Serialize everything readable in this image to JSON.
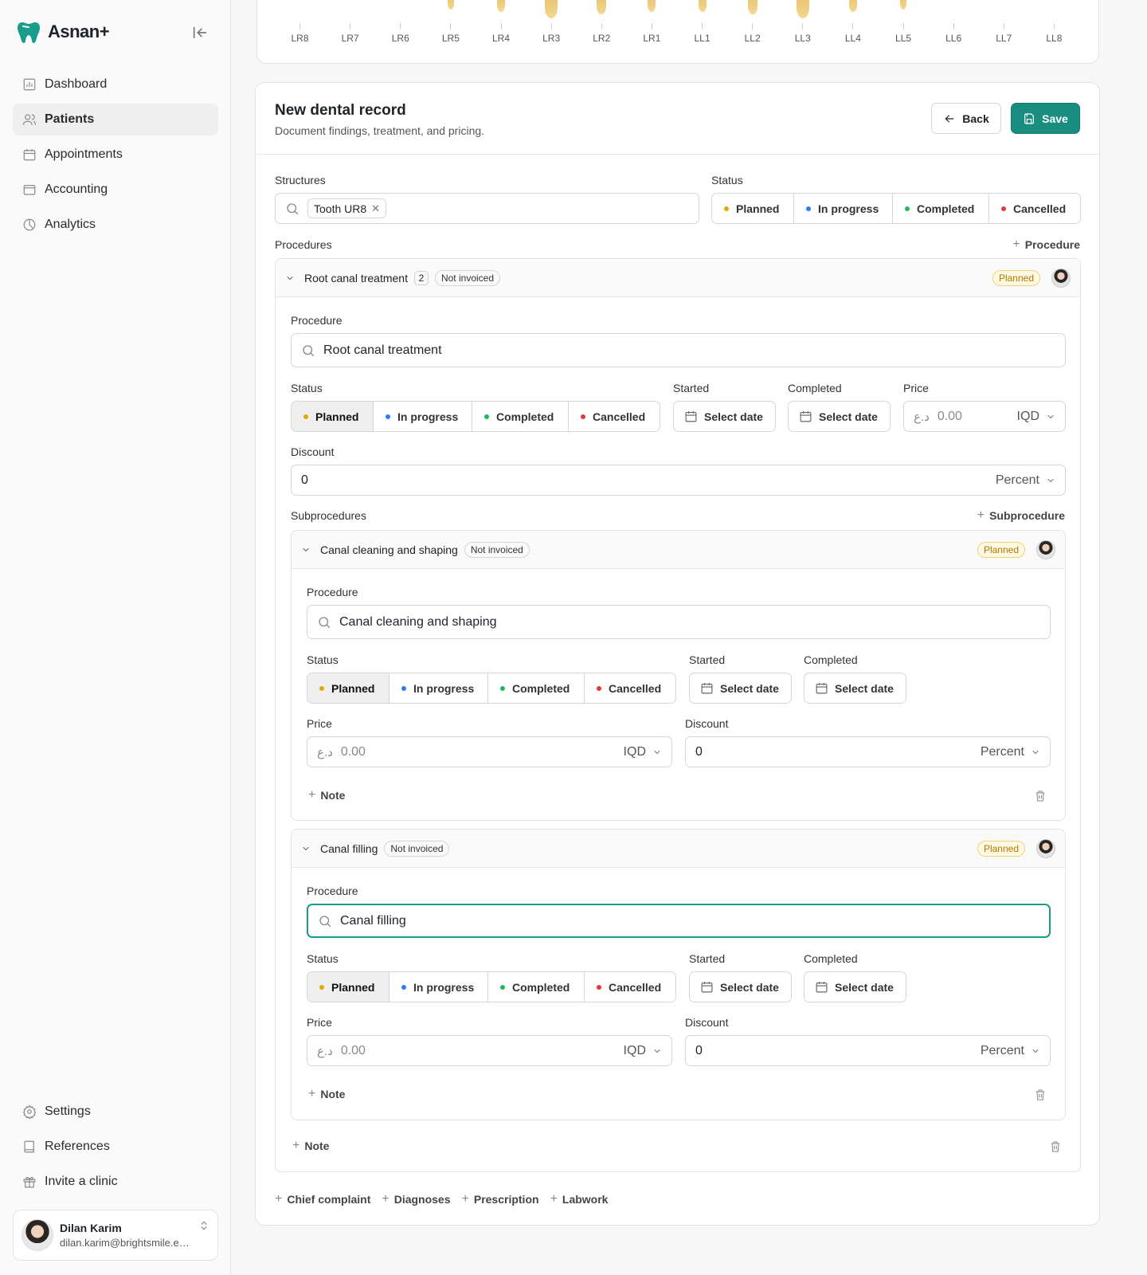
{
  "app": {
    "name": "Asnan+"
  },
  "sidebar": {
    "items": [
      {
        "label": "Dashboard",
        "icon": "chart-bar-icon"
      },
      {
        "label": "Patients",
        "icon": "users-icon"
      },
      {
        "label": "Appointments",
        "icon": "calendar-icon"
      },
      {
        "label": "Accounting",
        "icon": "wallet-icon"
      },
      {
        "label": "Analytics",
        "icon": "pie-chart-icon"
      }
    ],
    "bottom_items": [
      {
        "label": "Settings",
        "icon": "gear-icon"
      },
      {
        "label": "References",
        "icon": "book-icon"
      },
      {
        "label": "Invite a clinic",
        "icon": "gift-icon"
      }
    ],
    "user": {
      "name": "Dilan Karim",
      "email": "dilan.karim@brightsmile.ex..."
    }
  },
  "tooth_chart": {
    "labels": [
      "LR8",
      "LR7",
      "LR6",
      "LR5",
      "LR4",
      "LR3",
      "LR2",
      "LR1",
      "LL1",
      "LL2",
      "LL3",
      "LL4",
      "LL5",
      "LL6",
      "LL7",
      "LL8"
    ]
  },
  "record": {
    "title": "New dental record",
    "subtitle": "Document findings, treatment, and pricing.",
    "back_label": "Back",
    "save_label": "Save",
    "structures_label": "Structures",
    "structure_chip": "Tooth UR8",
    "status_label": "Status",
    "status_options": [
      "Planned",
      "In progress",
      "Completed",
      "Cancelled"
    ],
    "procedures_label": "Procedures",
    "add_procedure_label": "Procedure",
    "footer_links": [
      "Chief complaint",
      "Diagnoses",
      "Prescription",
      "Labwork"
    ]
  },
  "procedure": {
    "name": "Root canal treatment",
    "count": "2",
    "invoice_status": "Not invoiced",
    "status_badge": "Planned",
    "procedure_label": "Procedure",
    "procedure_value": "Root canal treatment",
    "status_label": "Status",
    "status_selected": "Planned",
    "started_label": "Started",
    "completed_label": "Completed",
    "date_placeholder": "Select date",
    "price_label": "Price",
    "currency_prefix": "د.ع",
    "price_placeholder": "0.00",
    "currency": "IQD",
    "discount_label": "Discount",
    "discount_value": "0",
    "discount_unit": "Percent",
    "subprocedures_label": "Subprocedures",
    "add_subprocedure_label": "Subprocedure",
    "note_label": "Note"
  },
  "subprocedures": [
    {
      "name": "Canal cleaning and shaping",
      "invoice_status": "Not invoiced",
      "status_badge": "Planned",
      "procedure_value": "Canal cleaning and shaping",
      "status_selected": "Planned",
      "price_placeholder": "0.00",
      "discount_value": "0",
      "note_label": "Note"
    },
    {
      "name": "Canal filling",
      "invoice_status": "Not invoiced",
      "status_badge": "Planned",
      "procedure_value": "Canal filling",
      "status_selected": "Planned",
      "price_placeholder": "0.00",
      "discount_value": "0",
      "note_label": "Note"
    }
  ],
  "colors": {
    "accent": "#1a8c80",
    "planned": "#e6a800",
    "in_progress": "#2f7bf5",
    "completed": "#1fb85a",
    "cancelled": "#e53935"
  }
}
